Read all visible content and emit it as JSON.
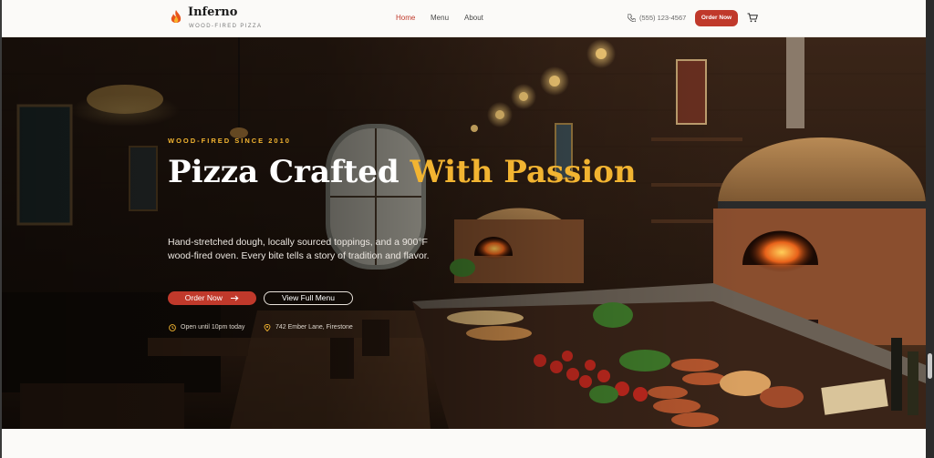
{
  "header": {
    "brand": "Inferno",
    "tagline": "WOOD-FIRED PIZZA",
    "nav": [
      "Home",
      "Menu",
      "About"
    ],
    "active_nav": "Home",
    "phone": "(555) 123-4567",
    "order_button": "Order Now",
    "icons": {
      "logo": "flame-icon",
      "phone": "phone-icon",
      "cart": "cart-icon"
    }
  },
  "hero": {
    "eyebrow": "WOOD-FIRED SINCE 2010",
    "title_part1": "Pizza Crafted ",
    "title_accent": "With Passion",
    "description": "Hand-stretched dough, locally sourced toppings, and a 900°F wood-fired oven. Every bite tells a story of tradition and flavor.",
    "primary_button": "Order Now",
    "primary_button_icon": "arrow-right-icon",
    "secondary_button": "View Full Menu",
    "hours": "Open until 10pm today",
    "address": "742 Ember Lane, Firestone",
    "icons": {
      "hours": "clock-icon",
      "address": "map-pin-icon"
    }
  },
  "colors": {
    "brand_red": "#c0392b",
    "accent_gold": "#f2b431",
    "page_bg": "#fbfaf8"
  }
}
